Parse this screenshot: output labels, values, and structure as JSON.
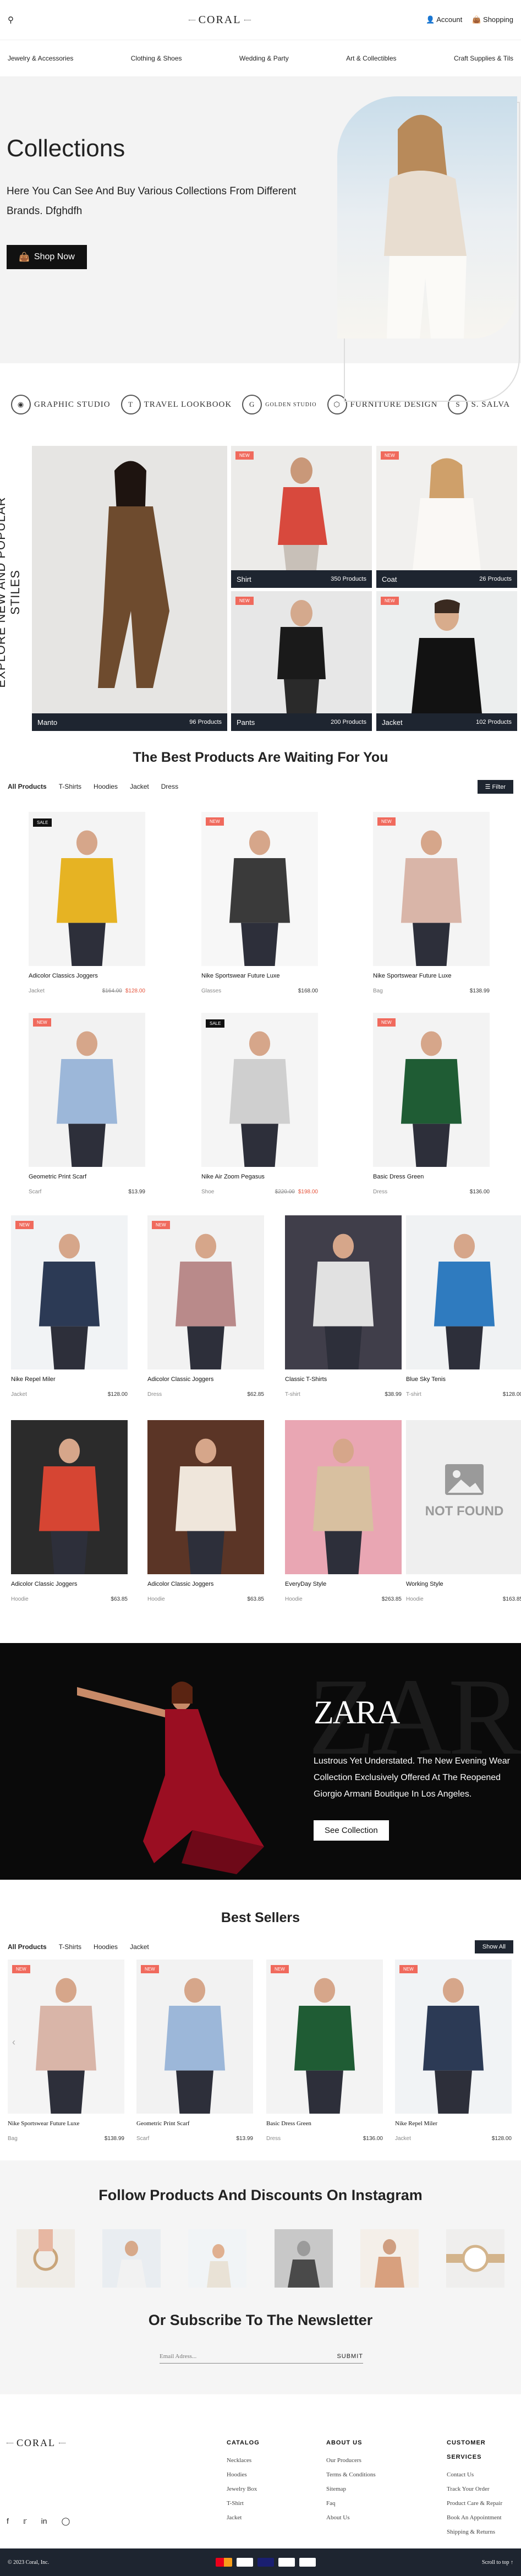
{
  "header": {
    "search_icon": "search-icon",
    "logo": "CORAL",
    "account": "Account",
    "shopping": "Shopping"
  },
  "nav": [
    "Jewelry & Accessories",
    "Clothing & Shoes",
    "Wedding & Party",
    "Art & Collectibles",
    "Craft Supplies & Tils"
  ],
  "hero": {
    "title": "Collections",
    "text": "Here You Can See And Buy Various Collections From Different Brands. Dfghdfh",
    "button": "Shop Now"
  },
  "brands": [
    "GRAPHIC STUDIO",
    "TRAVEL LOOKBOOK",
    "GOLDEN STUDIO",
    "FURNITURE DESIGN",
    "S. SALVA"
  ],
  "explore": {
    "vertical": "EXPLORE NEW AND POPULAR STILES",
    "tiles": [
      {
        "name": "Manto",
        "count": "96 Products",
        "tag": ""
      },
      {
        "name": "Shirt",
        "count": "350 Products",
        "tag": "NEW"
      },
      {
        "name": "Coat",
        "count": "26 Products",
        "tag": "NEW"
      },
      {
        "name": "Pants",
        "count": "200 Products",
        "tag": "NEW"
      },
      {
        "name": "Jacket",
        "count": "102 Products",
        "tag": "NEW"
      }
    ]
  },
  "best": {
    "title": "The Best Products Are Waiting For You",
    "tabs": [
      "All Products",
      "T-Shirts",
      "Hoodies",
      "Jacket",
      "Dress"
    ],
    "filter": "Filter"
  },
  "products": [
    {
      "name": "Adicolor Classics Joggers",
      "cat": "Jacket",
      "old": "$164.00",
      "price": "$128.00",
      "tag": "SALE",
      "sale": true
    },
    {
      "name": "Nike Sportswear Future Luxe",
      "cat": "Glasses",
      "price": "$168.00",
      "tag": "NEW"
    },
    {
      "name": "Nike Sportswear Future Luxe",
      "cat": "Bag",
      "price": "$138.99",
      "tag": "NEW"
    },
    {
      "name": "Geometric Print Scarf",
      "cat": "Scarf",
      "price": "$13.99",
      "tag": "NEW"
    },
    {
      "name": "Nike Air Zoom Pegasus",
      "cat": "Shoe",
      "old": "$220.00",
      "price": "$198.00",
      "tag": "SALE",
      "sale": true
    },
    {
      "name": "Basic Dress Green",
      "cat": "Dress",
      "price": "$136.00",
      "tag": "NEW"
    },
    {
      "name": "Nike Repel Miler",
      "cat": "Jacket",
      "price": "$128.00",
      "tag": "NEW"
    },
    {
      "name": "Adicolor Classic Joggers",
      "cat": "Dress",
      "price": "$62.85",
      "tag": "NEW"
    },
    {
      "name": "Classic T-Shirts",
      "cat": "T-shirt",
      "price": "$38.99",
      "tag": ""
    },
    {
      "name": "Blue Sky Tenis",
      "cat": "T-shirt",
      "price": "$128.00",
      "tag": ""
    },
    {
      "name": "Adicolor Classic Joggers",
      "cat": "Hoodie",
      "price": "$63.85",
      "tag": ""
    },
    {
      "name": "Adicolor Classic Joggers",
      "cat": "Hoodie",
      "price": "$63.85",
      "tag": ""
    },
    {
      "name": "EveryDay Style",
      "cat": "Hoodie",
      "price": "$263.85",
      "tag": ""
    },
    {
      "name": "Working Style",
      "cat": "Hoodie",
      "price": "$163.85",
      "tag": "",
      "notfound": "NOT FOUND"
    }
  ],
  "banner": {
    "brand": "ZARA",
    "text": "Lustrous Yet Understated. The New Evening Wear Collection Exclusively Offered At The Reopened Giorgio Armani Boutique In Los Angeles.",
    "button": "See Collection"
  },
  "bestsellers": {
    "title": "Best Sellers",
    "tabs": [
      "All Products",
      "T-Shirts",
      "Hoodies",
      "Jacket"
    ],
    "show": "Show All",
    "items": [
      {
        "name": "Nike Sportswear Future Luxe",
        "cat": "Bag",
        "price": "$138.99",
        "tag": "NEW"
      },
      {
        "name": "Geometric Print Scarf",
        "cat": "Scarf",
        "price": "$13.99",
        "tag": "NEW"
      },
      {
        "name": "Basic Dress Green",
        "cat": "Dress",
        "price": "$136.00",
        "tag": "NEW"
      },
      {
        "name": "Nike Repel Miler",
        "cat": "Jacket",
        "price": "$128.00",
        "tag": "NEW"
      }
    ]
  },
  "instagram": {
    "title": "Follow Products And Discounts On Instagram",
    "newsletter": "Or Subscribe To The Newsletter",
    "placeholder": "Email Adress...",
    "submit": "SUBMIT"
  },
  "footer": {
    "logo": "CORAL",
    "catalog": {
      "title": "CATALOG",
      "items": [
        "Necklaces",
        "Hoodies",
        "Jewelry Box",
        "T-Shirt",
        "Jacket"
      ]
    },
    "about": {
      "title": "ABOUT US",
      "items": [
        "Our Producers",
        "Terms & Conditions",
        "Sitemap",
        "Faq",
        "About Us"
      ]
    },
    "service": {
      "title": "CUSTOMER SERVICES",
      "items": [
        "Contact Us",
        "Track Your Order",
        "Product Care & Repair",
        "Book An Appointment",
        "Shipping & Returns"
      ]
    },
    "copyright": "© 2023 Coral, Inc.",
    "scroll": "Scroll to top ↑"
  }
}
